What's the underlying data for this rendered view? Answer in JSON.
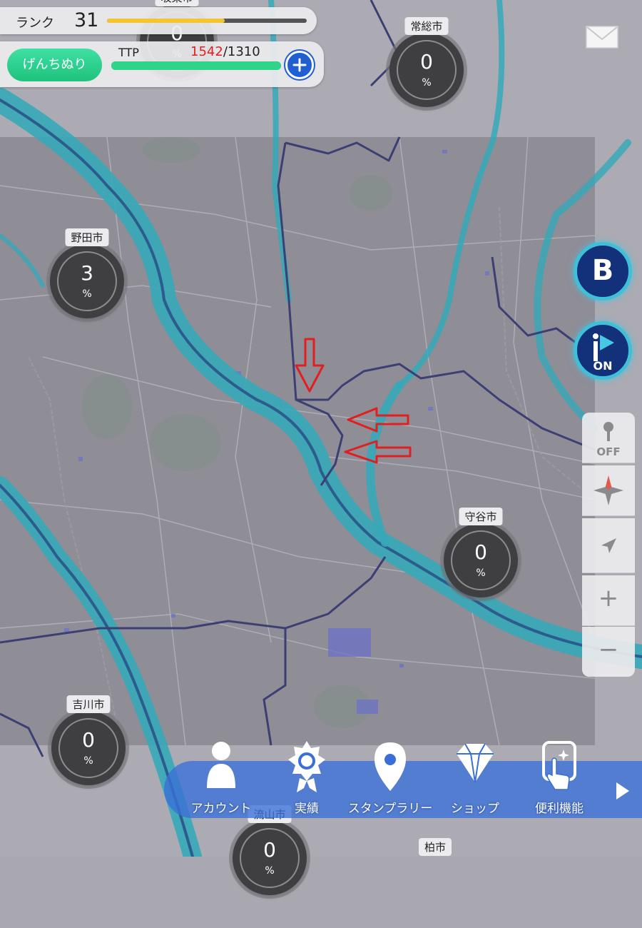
{
  "header": {
    "rank_label": "ランク",
    "rank_value": "31",
    "rank_progress": 0.59,
    "mode_button": "げんちぬり",
    "ttp_label": "TTP",
    "ttp_current": "1542",
    "ttp_total": "/1310",
    "ttp_progress": 1.0
  },
  "cities": [
    {
      "name": "坂東市",
      "value": "0",
      "unit": "%"
    },
    {
      "name": "常総市",
      "value": "0",
      "unit": "%"
    },
    {
      "name": "野田市",
      "value": "3",
      "unit": "%"
    },
    {
      "name": "守谷市",
      "value": "0",
      "unit": "%"
    },
    {
      "name": "吉川市",
      "value": "0",
      "unit": "%"
    },
    {
      "name": "流山市",
      "value": "0",
      "unit": "%"
    },
    {
      "name": "柏市",
      "value": "",
      "unit": ""
    }
  ],
  "side_buttons": {
    "b_label": "B",
    "info_on_label": "ON",
    "location_off_label": "OFF",
    "zoom_in": "+",
    "zoom_out": "−"
  },
  "bottom_nav": [
    {
      "label": "アカウント",
      "icon": "person-icon"
    },
    {
      "label": "実績",
      "icon": "medal-icon"
    },
    {
      "label": "スタンプラリー",
      "icon": "map-pin-icon"
    },
    {
      "label": "ショップ",
      "icon": "diamond-icon"
    },
    {
      "label": "便利機能",
      "icon": "touch-sparkle-icon"
    }
  ],
  "icons": {
    "mail": "mail-icon",
    "plus": "plus-icon",
    "compass": "compass-icon",
    "locate": "navigation-arrow-icon",
    "next": "play-arrow-icon"
  },
  "colors": {
    "river": "#35a9b8",
    "river_dark": "#2c5c8e",
    "boundary": "#3b3f74",
    "rank_bar": "#f2c531",
    "ttp_bar": "#2fd38a",
    "accent_red": "#e02020",
    "nav_blue": "#3a6fd8"
  }
}
